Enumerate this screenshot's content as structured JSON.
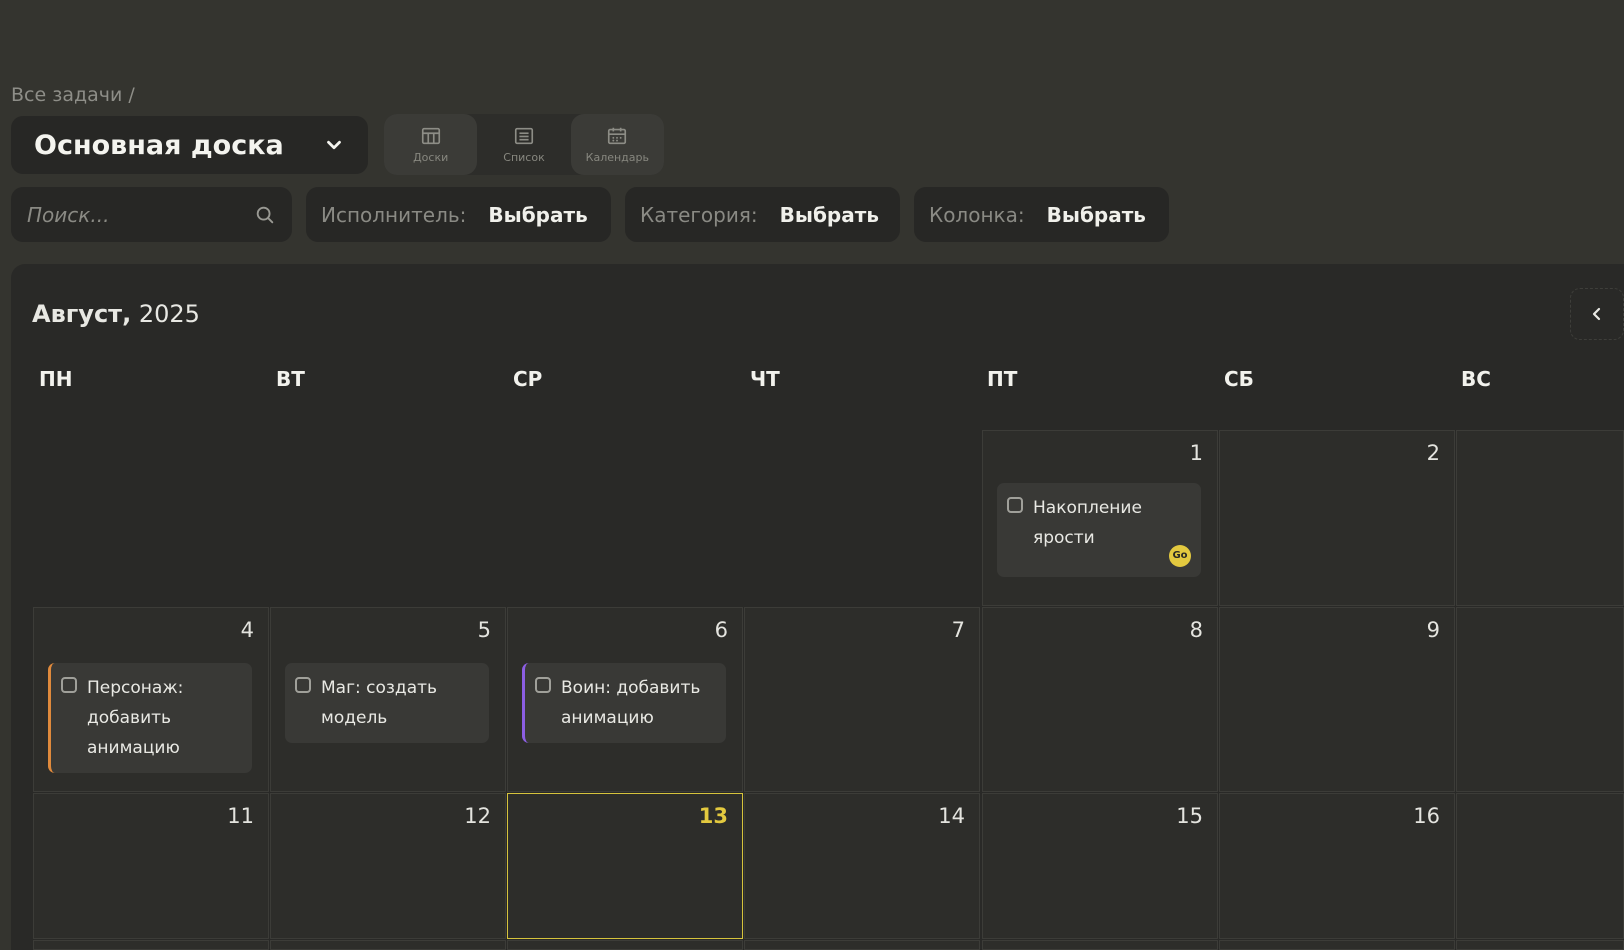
{
  "breadcrumb": "Все задачи /",
  "board": {
    "title": "Основная доска"
  },
  "views": [
    {
      "label": "Доски",
      "icon": "board-icon",
      "active": true
    },
    {
      "label": "Список",
      "icon": "list-icon",
      "active": false
    },
    {
      "label": "Календарь",
      "icon": "calendar-icon",
      "active": true
    }
  ],
  "search": {
    "placeholder": "Поиск..."
  },
  "filters": [
    {
      "label": "Исполнитель:",
      "value": "Выбрать"
    },
    {
      "label": "Категория:",
      "value": "Выбрать"
    },
    {
      "label": "Колонка:",
      "value": "Выбрать"
    }
  ],
  "calendar": {
    "month": "Август,",
    "year": "2025",
    "weekdays": [
      "ПН",
      "ВТ",
      "СР",
      "ЧТ",
      "ПТ",
      "СБ",
      "ВС"
    ],
    "today": "13",
    "days": {
      "d1": "1",
      "d2": "2",
      "d4": "4",
      "d5": "5",
      "d6": "6",
      "d7": "7",
      "d8": "8",
      "d9": "9",
      "d11": "11",
      "d12": "12",
      "d13": "13",
      "d14": "14",
      "d15": "15",
      "d16": "16"
    },
    "tasks": {
      "t1": {
        "title": "Накопление ярости",
        "badge": "Go"
      },
      "t4": {
        "title": "Персонаж: добавить анимацию",
        "accent": "#e08a3c"
      },
      "t5": {
        "title": "Маг: создать модель"
      },
      "t6": {
        "title": "Воин: добавить анимацию",
        "accent": "#8c5ee3"
      }
    }
  },
  "colors": {
    "background": "#34342f",
    "panel": "#292927",
    "today_accent": "#e3c93f"
  }
}
